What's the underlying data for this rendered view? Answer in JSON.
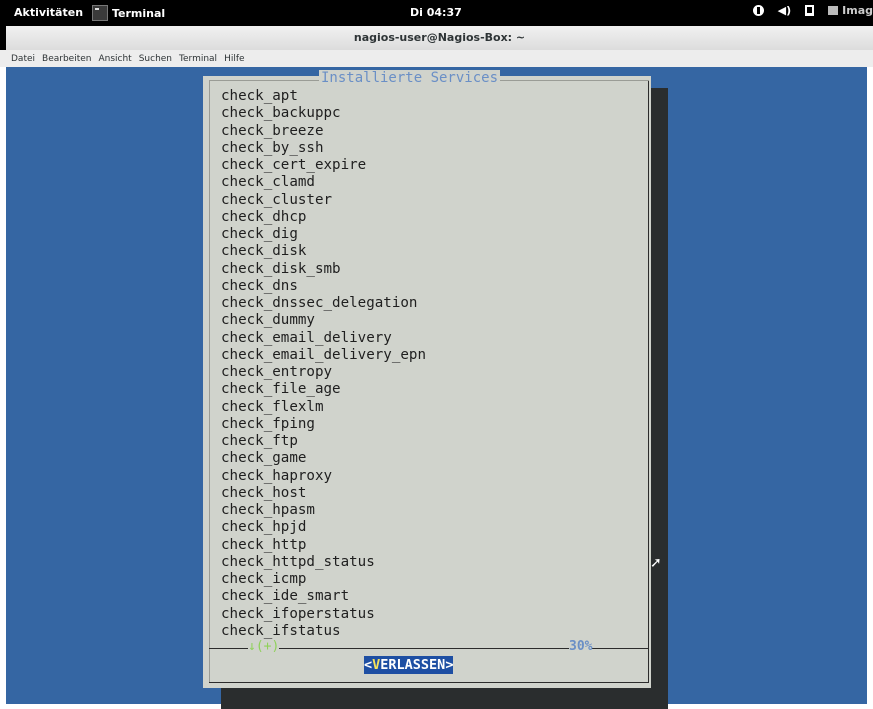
{
  "topbar": {
    "activities": "Aktivitäten",
    "app_name": "Terminal",
    "clock": "Di 04:37",
    "tray_label": "Imag"
  },
  "window": {
    "title": "nagios-user@Nagios-Box: ~"
  },
  "menu": [
    "Datei",
    "Bearbeiten",
    "Ansicht",
    "Suchen",
    "Terminal",
    "Hilfe"
  ],
  "dialog": {
    "title": "Installierte Services",
    "items": [
      "check_apt",
      "check_backuppc",
      "check_breeze",
      "check_by_ssh",
      "check_cert_expire",
      "check_clamd",
      "check_cluster",
      "check_dhcp",
      "check_dig",
      "check_disk",
      "check_disk_smb",
      "check_dns",
      "check_dnssec_delegation",
      "check_dummy",
      "check_email_delivery",
      "check_email_delivery_epn",
      "check_entropy",
      "check_file_age",
      "check_flexlm",
      "check_fping",
      "check_ftp",
      "check_game",
      "check_haproxy",
      "check_host",
      "check_hpasm",
      "check_hpjd",
      "check_http",
      "check_httpd_status",
      "check_icmp",
      "check_ide_smart",
      "check_ifoperstatus",
      "check_ifstatus"
    ],
    "scroll_indicator": "↓(+)",
    "scroll_percent": "30%",
    "button": {
      "open": "<",
      "hotkey": "V",
      "rest": "ERLASSEN",
      "close": ">"
    }
  },
  "colors": {
    "terminal_bg": "#3566a3",
    "dialog_bg": "#d0d3cc",
    "title": "#6a8fc6",
    "button_bg": "#1e4fa3",
    "hotkey": "#f5e35c",
    "indicator": "#8fd15a"
  },
  "icons": [
    "terminal-app-icon",
    "accessibility-icon",
    "volume-icon",
    "network-icon",
    "image-icon",
    "mouse-cursor-icon"
  ]
}
